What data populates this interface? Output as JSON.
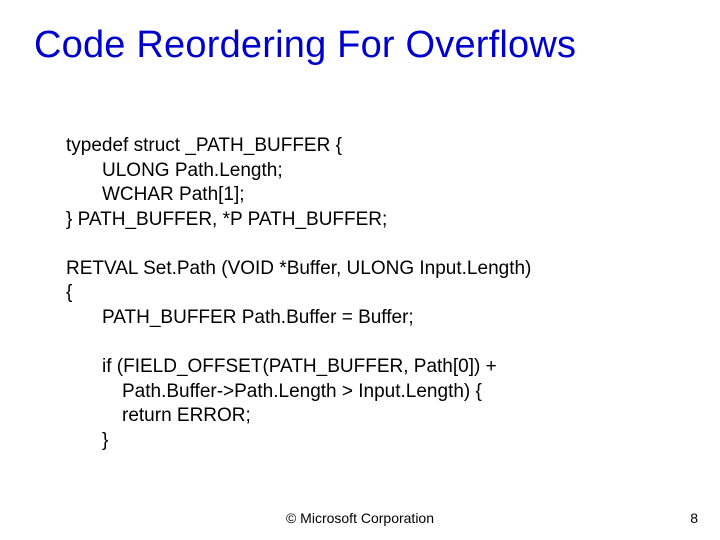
{
  "title": "Code Reordering For Overflows",
  "code": {
    "l1": "typedef struct _PATH_BUFFER {",
    "l2": "ULONG Path.Length;",
    "l3": "WCHAR Path[1];",
    "l4": "} PATH_BUFFER, *P PATH_BUFFER;",
    "l5": "RETVAL Set.Path (VOID *Buffer, ULONG Input.Length)",
    "l6": "{",
    "l7": "PATH_BUFFER Path.Buffer = Buffer;",
    "l8": "if (FIELD_OFFSET(PATH_BUFFER, Path[0]) +",
    "l9": "Path.Buffer->Path.Length > Input.Length) {",
    "l10": "return ERROR;",
    "l11": "}"
  },
  "footer": {
    "copyright": "© Microsoft Corporation",
    "page": "8"
  }
}
